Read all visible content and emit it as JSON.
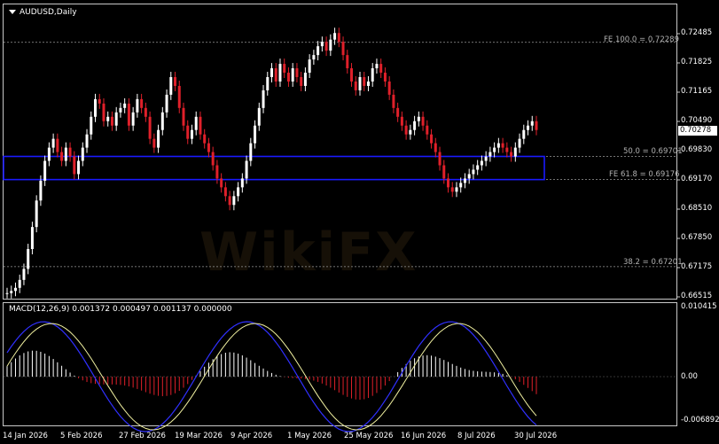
{
  "header": {
    "symbol_label": "AUDUSD,Daily"
  },
  "macd": {
    "label": "MACD(12,26,9) 0.001372 0.000497 0.001137 0.000000"
  },
  "price_axis": {
    "ticks": [
      "0.72485",
      "0.71825",
      "0.71165",
      "0.70490",
      "0.69830",
      "0.69170",
      "0.68510",
      "0.67850",
      "0.67175",
      "0.66515"
    ],
    "current": "0.70278"
  },
  "macd_axis": {
    "ticks": [
      "0.010415",
      "0.00",
      "-0.006892"
    ]
  },
  "date_axis": {
    "labels": [
      "14 Jan 2026",
      "5 Feb 2026",
      "27 Feb 2026",
      "19 Mar 2026",
      "9 Apr 2026",
      "1 May 2026",
      "25 May 2026",
      "16 Jun 2026",
      "8 Jul 2026",
      "30 Jul 2026"
    ]
  },
  "fib_levels": [
    {
      "label": "FE 100.0 = 0.72289",
      "value": 0.72289
    },
    {
      "label": "50.0 = 0.69701",
      "value": 0.69701
    },
    {
      "label": "FE 61.8 = 0.69176",
      "value": 0.69176
    },
    {
      "label": "38.2 = 0.67201",
      "value": 0.67201
    }
  ],
  "watermark": {
    "text": "WikiFX"
  },
  "colors": {
    "bull": "#ffffff",
    "bear": "#e0202a",
    "zone": "#1a1aff",
    "macd_signal": "#f0f0a0",
    "macd_line": "#3030ff"
  }
}
